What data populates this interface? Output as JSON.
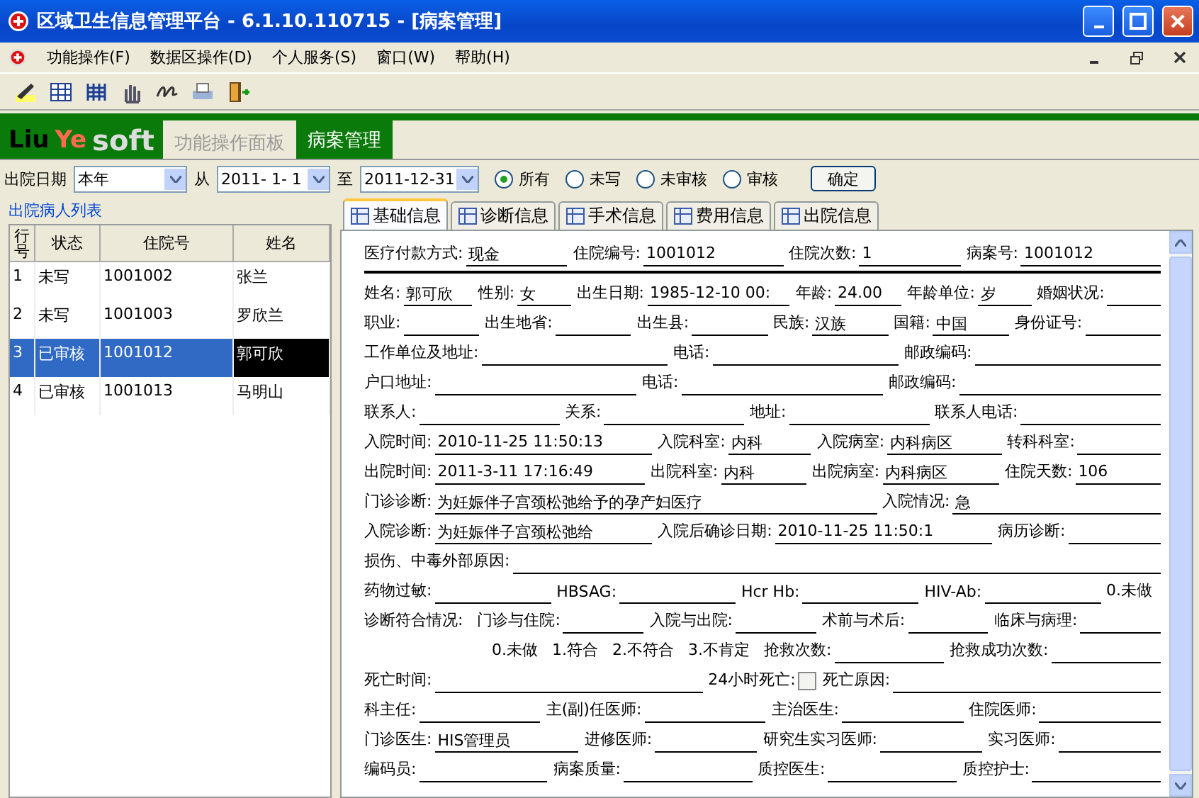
{
  "window": {
    "title": "区域卫生信息管理平台 - 6.1.10.110715 - [病案管理]"
  },
  "menu": [
    "功能操作(F)",
    "数据区操作(D)",
    "个人服务(S)",
    "窗口(W)",
    "帮助(H)"
  ],
  "logo": [
    "Liu",
    "Ye",
    "soft"
  ],
  "panel_tabs": [
    {
      "label": "功能操作面板",
      "selected": false
    },
    {
      "label": "病案管理",
      "selected": true
    }
  ],
  "filter": {
    "label": "出院日期",
    "period": "本年",
    "from_label": "从",
    "from": "2011- 1- 1",
    "to_label": "至",
    "to": "2011-12-31",
    "radios": [
      {
        "label": "所有",
        "selected": true
      },
      {
        "label": "未写",
        "selected": false
      },
      {
        "label": "未审核",
        "selected": false
      },
      {
        "label": "审核",
        "selected": false
      }
    ],
    "button": "确定"
  },
  "patient_list": {
    "title": "出院病人列表",
    "columns": [
      "行号",
      "状态",
      "住院号",
      "姓名"
    ],
    "rows": [
      {
        "cells": [
          "1",
          "未写",
          "1001002",
          "张兰"
        ],
        "selected": false
      },
      {
        "cells": [
          "2",
          "未写",
          "1001003",
          "罗欣兰"
        ],
        "selected": false
      },
      {
        "cells": [
          "3",
          "已审核",
          "1001012",
          "郭可欣"
        ],
        "selected": true
      },
      {
        "cells": [
          "4",
          "已审核",
          "1001013",
          "马明山"
        ],
        "selected": false
      }
    ]
  },
  "tabs": [
    {
      "label": "基础信息",
      "selected": true
    },
    {
      "label": "诊断信息",
      "selected": false
    },
    {
      "label": "手术信息",
      "selected": false
    },
    {
      "label": "费用信息",
      "selected": false
    },
    {
      "label": "出院信息",
      "selected": false
    }
  ],
  "form_rows": [
    [
      {
        "kind": "field",
        "label": "医疗付款方式:",
        "value": "现金"
      },
      {
        "kind": "field",
        "label": "住院编号:",
        "value": "1001012"
      },
      {
        "kind": "field",
        "label": "住院次数:",
        "value": "1"
      },
      {
        "kind": "field",
        "label": "病案号:",
        "value": "1001012"
      }
    ],
    [
      {
        "kind": "rule"
      }
    ],
    [
      {
        "kind": "field",
        "label": "姓名:",
        "value": "郭可欣"
      },
      {
        "kind": "field",
        "label": "性别:",
        "value": "女"
      },
      {
        "kind": "field",
        "label": "出生日期:",
        "value": "1985-12-10 00:"
      },
      {
        "kind": "field",
        "label": "年龄:",
        "value": "24.00"
      },
      {
        "kind": "field",
        "label": "年龄单位:",
        "value": "岁"
      },
      {
        "kind": "field",
        "label": "婚姻状况:"
      }
    ],
    [
      {
        "kind": "field",
        "label": "职业:"
      },
      {
        "kind": "field",
        "label": "出生地省:"
      },
      {
        "kind": "field",
        "label": "出生县:"
      },
      {
        "kind": "field",
        "label": "民族:",
        "value": "汉族"
      },
      {
        "kind": "field",
        "label": "国籍:",
        "value": "中国"
      },
      {
        "kind": "field",
        "label": "身份证号:"
      }
    ],
    [
      {
        "kind": "field",
        "label": "工作单位及地址:"
      },
      {
        "kind": "field",
        "label": "电话:"
      },
      {
        "kind": "field",
        "label": "邮政编码:"
      }
    ],
    [
      {
        "kind": "field",
        "label": "户口地址:"
      },
      {
        "kind": "field",
        "label": "电话:"
      },
      {
        "kind": "field",
        "label": "邮政编码:"
      }
    ],
    [
      {
        "kind": "field",
        "label": "联系人:"
      },
      {
        "kind": "field",
        "label": "关系:"
      },
      {
        "kind": "field",
        "label": "地址:"
      },
      {
        "kind": "field",
        "label": "联系人电话:"
      }
    ],
    [
      {
        "kind": "field",
        "label": "入院时间:",
        "value": "2010-11-25 11:50:13"
      },
      {
        "kind": "field",
        "label": "入院科室:",
        "value": "内科"
      },
      {
        "kind": "field",
        "label": "入院病室:",
        "value": "内科病区"
      },
      {
        "kind": "field",
        "label": "转科科室:"
      }
    ],
    [
      {
        "kind": "field",
        "label": "出院时间:",
        "value": "2011-3-11 17:16:49"
      },
      {
        "kind": "field",
        "label": "出院科室:",
        "value": "内科"
      },
      {
        "kind": "field",
        "label": "出院病室:",
        "value": "内科病区"
      },
      {
        "kind": "field",
        "label": "住院天数:",
        "value": "106"
      }
    ],
    [
      {
        "kind": "field",
        "label": "门诊诊断:",
        "value": "为妊娠伴子宫颈松弛给予的孕产妇医疗"
      },
      {
        "kind": "field",
        "label": "入院情况:",
        "value": "急"
      }
    ],
    [
      {
        "kind": "field",
        "label": "入院诊断:",
        "value": "为妊娠伴子宫颈松弛给"
      },
      {
        "kind": "field",
        "label": "入院后确诊日期:",
        "value": "2010-11-25 11:50:1"
      },
      {
        "kind": "field",
        "label": "病历诊断:"
      }
    ],
    [
      {
        "kind": "field",
        "label": "损伤、中毒外部原因:"
      }
    ],
    [
      {
        "kind": "field",
        "label": "药物过敏:"
      },
      {
        "kind": "field",
        "label": "HBSAG:"
      },
      {
        "kind": "field",
        "label": "Hcr Hb:"
      },
      {
        "kind": "field",
        "label": "HIV-Ab:"
      },
      {
        "kind": "text",
        "label": "0.未做"
      }
    ],
    [
      {
        "kind": "text",
        "label": "诊断符合情况:"
      },
      {
        "kind": "field",
        "label": "门诊与住院:"
      },
      {
        "kind": "field",
        "label": "入院与出院:"
      },
      {
        "kind": "field",
        "label": "术前与术后:"
      },
      {
        "kind": "field",
        "label": "临床与病理:"
      }
    ],
    [
      {
        "kind": "text",
        "label": "0.未做"
      },
      {
        "kind": "text",
        "label": "1.符合"
      },
      {
        "kind": "text",
        "label": "2.不符合"
      },
      {
        "kind": "text",
        "label": "3.不肯定"
      },
      {
        "kind": "field",
        "label": "抢救次数:"
      },
      {
        "kind": "field",
        "label": "抢救成功次数:"
      }
    ],
    [
      {
        "kind": "field",
        "label": "死亡时间:"
      },
      {
        "kind": "checkbox",
        "label": "24小时死亡:",
        "checked": false
      },
      {
        "kind": "field",
        "label": "死亡原因:"
      }
    ],
    [
      {
        "kind": "field",
        "label": "科主任:"
      },
      {
        "kind": "field",
        "label": "主(副)任医师:"
      },
      {
        "kind": "field",
        "label": "主治医生:"
      },
      {
        "kind": "field",
        "label": "住院医师:"
      }
    ],
    [
      {
        "kind": "field",
        "label": "门诊医生:",
        "value": "HIS管理员"
      },
      {
        "kind": "field",
        "label": "进修医师:"
      },
      {
        "kind": "field",
        "label": "研究生实习医师:"
      },
      {
        "kind": "field",
        "label": "实习医师:"
      }
    ],
    [
      {
        "kind": "field",
        "label": "编码员:"
      },
      {
        "kind": "field",
        "label": "病案质量:"
      },
      {
        "kind": "field",
        "label": "质控医生:"
      },
      {
        "kind": "field",
        "label": "质控护士:"
      }
    ]
  ]
}
